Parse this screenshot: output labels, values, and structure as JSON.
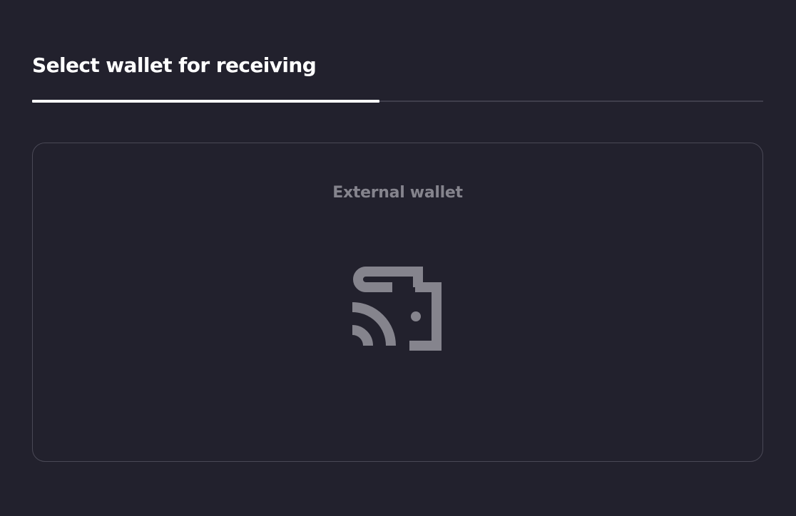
{
  "header": {
    "title": "Select wallet for receiving"
  },
  "progress": {
    "value": 0.475
  },
  "wallet_options": [
    {
      "label": "External wallet",
      "icon": "external-wallet-icon"
    }
  ],
  "colors": {
    "background": "#22212d",
    "title": "#ffffff",
    "muted": "#85848d",
    "border": "#4a4956",
    "track": "#3f3e4b"
  }
}
